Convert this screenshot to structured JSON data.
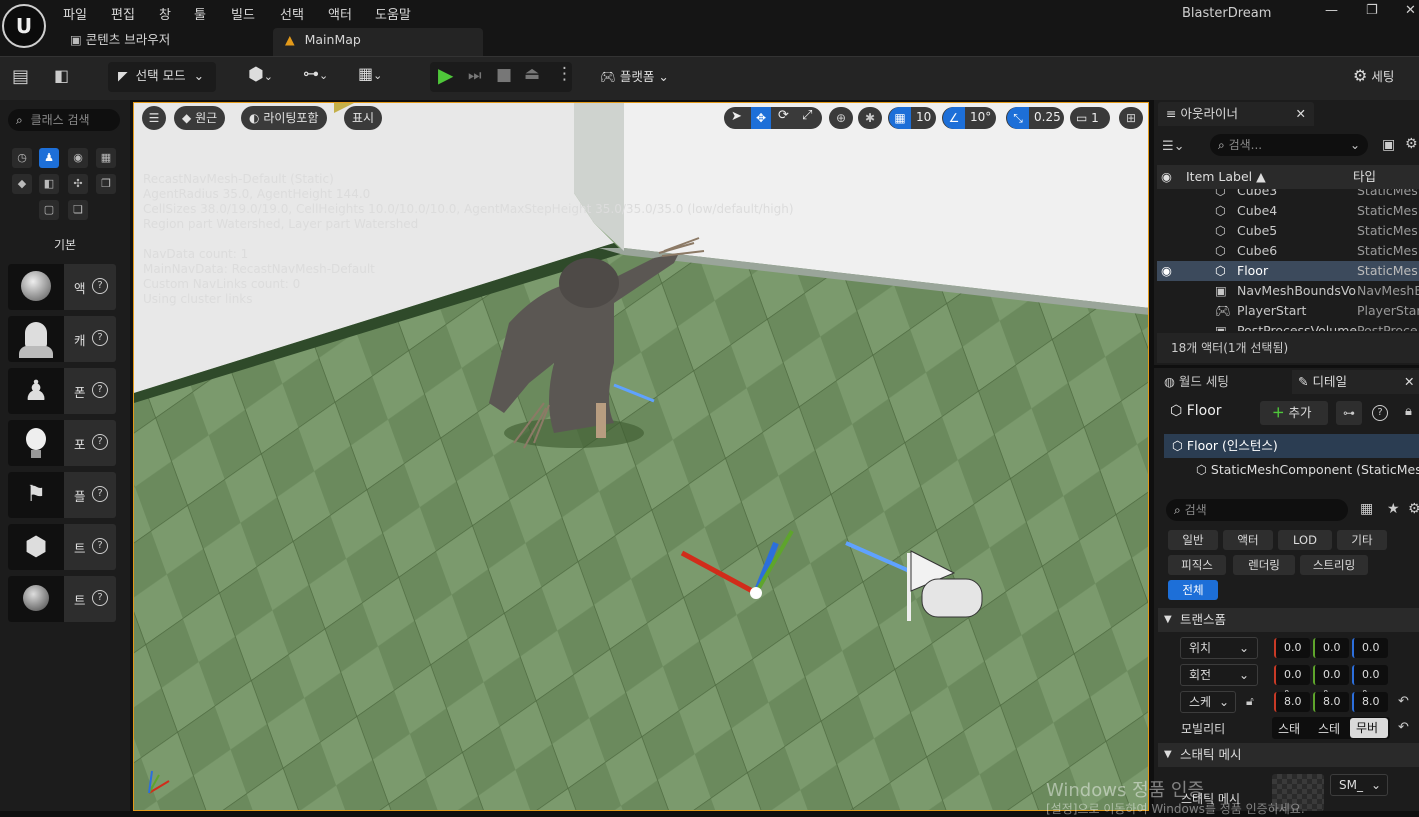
{
  "titlebar": {
    "logo": "U",
    "menus": [
      "파일",
      "편집",
      "창",
      "툴",
      "빌드",
      "선택",
      "액터",
      "도움말"
    ],
    "app_name": "BlasterDream",
    "win_minimize": "—",
    "win_restore": "❐",
    "win_close": "✕"
  },
  "tabs": {
    "content_browser": "콘텐츠 브라우저",
    "main_map": "MainMap"
  },
  "toolbar": {
    "mode": "선택 모드",
    "platform": "플랫폼",
    "settings": "세팅"
  },
  "left_panel": {
    "search_placeholder": "클래스 검색",
    "category_title": "기본",
    "items": [
      {
        "label": "액",
        "icon": "sphere-icon"
      },
      {
        "label": "캐",
        "icon": "character-icon"
      },
      {
        "label": "폰",
        "icon": "pawn-icon"
      },
      {
        "label": "포",
        "icon": "point-light-icon"
      },
      {
        "label": "플",
        "icon": "player-start-icon"
      },
      {
        "label": "트",
        "icon": "trigger-box-icon"
      },
      {
        "label": "트",
        "icon": "trigger-sphere-icon"
      }
    ]
  },
  "viewport": {
    "btn_perspective": "원근",
    "btn_lighting": "라이팅포함",
    "btn_show": "표시",
    "grid_snap": "10",
    "rot_snap": "10°",
    "scale_snap": "0.25",
    "camera_speed": "1",
    "debug_lines": [
      "RecastNavMesh-Default (Static)",
      "AgentRadius 35.0, AgentHeight 144.0",
      "CellSizes 38.0/19.0/19.0, CellHeights 10.0/10.0/10.0, AgentMaxStepHeight 35.0/35.0/35.0 (low/default/high)",
      "Region part Watershed, Layer part Watershed",
      "",
      "NavData count: 1",
      "MainNavData: RecastNavMesh-Default",
      "Custom NavLinks count: 0",
      "Using cluster links"
    ],
    "watermark_line1": "Windows 정품 인증",
    "watermark_line2": "[설정]으로 이동하여 Windows를 정품 인증하세요."
  },
  "outliner": {
    "tab_title": "아웃라이너",
    "search_placeholder": "검색...",
    "col_label": "Item Label ▲",
    "col_type": "타입",
    "rows": [
      {
        "label": "Cube3",
        "type": "StaticMes"
      },
      {
        "label": "Cube4",
        "type": "StaticMes"
      },
      {
        "label": "Cube5",
        "type": "StaticMes"
      },
      {
        "label": "Cube6",
        "type": "StaticMes"
      },
      {
        "label": "Floor",
        "type": "StaticMes"
      },
      {
        "label": "NavMeshBoundsVo",
        "type": "NavMeshB"
      },
      {
        "label": "PlayerStart",
        "type": "PlayerStar"
      },
      {
        "label": "PostProcessVolume",
        "type": "PostProce"
      }
    ],
    "footer": "18개 액터(1개 선택됨)"
  },
  "details": {
    "tab_world": "월드 세팅",
    "tab_details": "디테일",
    "actor_name": "Floor",
    "add_btn": "추가",
    "instance_row": "Floor (인스턴스)",
    "component_row": "StaticMeshComponent (StaticMesh",
    "search_placeholder": "검색",
    "filters": [
      "일반",
      "액터",
      "LOD",
      "기타",
      "피직스",
      "렌더링",
      "스트리밍",
      "전체"
    ],
    "section_transform": "트랜스폼",
    "location_label": "위치",
    "location": [
      "0.0",
      "0.0",
      "0.0"
    ],
    "rotation_label": "회전",
    "rotation": [
      "0.0 °",
      "0.0 °",
      "0.0 °"
    ],
    "scale_label": "스케",
    "scale": [
      "8.0",
      "8.0",
      "8.0"
    ],
    "mobility_label": "모빌리티",
    "mobility_options": [
      "스태",
      "스테",
      "무버"
    ],
    "section_mesh": "스태틱 메시",
    "static_mesh_label": "스태틱 메시",
    "static_mesh_value": "SM_"
  }
}
